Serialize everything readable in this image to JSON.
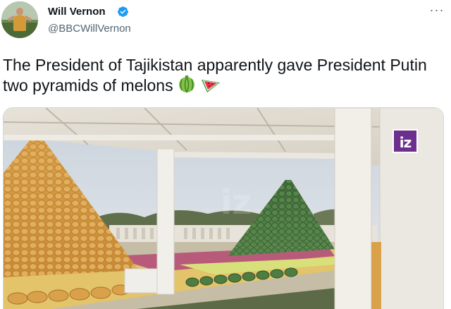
{
  "author": {
    "display_name": "Will Vernon",
    "handle": "@BBCWillVernon",
    "verified": true
  },
  "menu": {
    "more_label": "···"
  },
  "tweet": {
    "text": "The President of Tajikistan apparently gave President Putin two pyramids of melons",
    "emojis": [
      "melon-emoji",
      "watermelon-emoji"
    ]
  },
  "media": {
    "channel_logo": "iz",
    "accent_color": "#6c2f8e"
  },
  "colors": {
    "verified_badge": "#1d9bf0",
    "text": "#0f1419",
    "secondary_text": "#536471"
  }
}
